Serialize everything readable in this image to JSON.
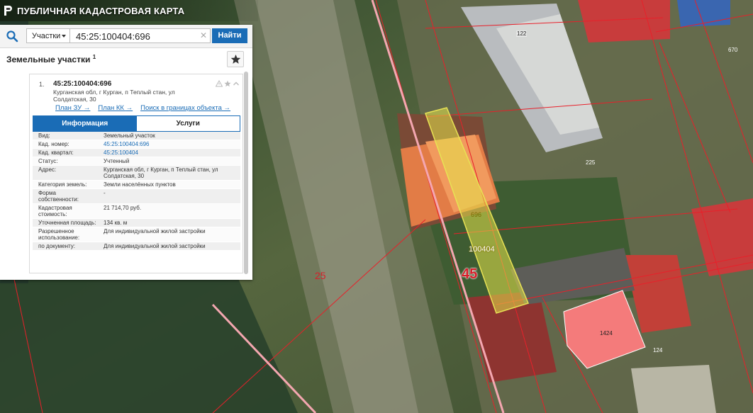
{
  "header": {
    "app_title": "ПУБЛИЧНАЯ КАДАСТРОВАЯ КАРТА"
  },
  "search": {
    "type_selected": "Участки",
    "query": "45:25:100404:696",
    "find_label": "Найти"
  },
  "section": {
    "title": "Земельные участки",
    "count": "1"
  },
  "result": {
    "index": "1.",
    "cad_number": "45:25:100404:696",
    "address": "Курганская обл, г Курган, п Теплый стан, ул Солдатская, 30",
    "links": [
      {
        "label": "План ЗУ"
      },
      {
        "label": "План КК"
      },
      {
        "label": "Поиск в границах объекта"
      }
    ],
    "tabs": [
      {
        "label": "Информация"
      },
      {
        "label": "Услуги"
      }
    ],
    "rows": [
      {
        "label": "Вид:",
        "value": "Земельный участок"
      },
      {
        "label": "Кад. номер:",
        "value": "45:25:100404:696"
      },
      {
        "label": "Кад. квартал:",
        "value": "45:25:100404"
      },
      {
        "label": "Статус:",
        "value": "Учтенный"
      },
      {
        "label": "Адрес:",
        "value": "Курганская обл, г Курган, п Теплый стан, ул Солдатская, 30"
      },
      {
        "label": "Категория земель:",
        "value": "Земли населённых пунктов"
      },
      {
        "label": "Форма собственности:",
        "value": "-"
      },
      {
        "label": "Кадастровая стоимость:",
        "value": "21 714,70 руб."
      },
      {
        "label": "Уточненная площадь:",
        "value": "134 кв. м"
      },
      {
        "label": "Разрешенное использование:",
        "value": "Для индивидуальной жилой застройки"
      },
      {
        "label": "по документу:",
        "value": "Для индивидуальной жилой застройки"
      }
    ]
  },
  "map": {
    "labels": {
      "parcel_number": "696",
      "quarter_label": "100404",
      "region_label": "45",
      "left_label": "25",
      "n122": "122",
      "n670": "670",
      "n225": "225",
      "n1424": "1424",
      "n124": "124"
    }
  },
  "colors": {
    "accent": "#1a6cb6",
    "parcel_fill": "#e4e34a",
    "boundary": "#e8202a",
    "highlight_building": "#f47b7b",
    "red_roof": "#c83c3c"
  }
}
